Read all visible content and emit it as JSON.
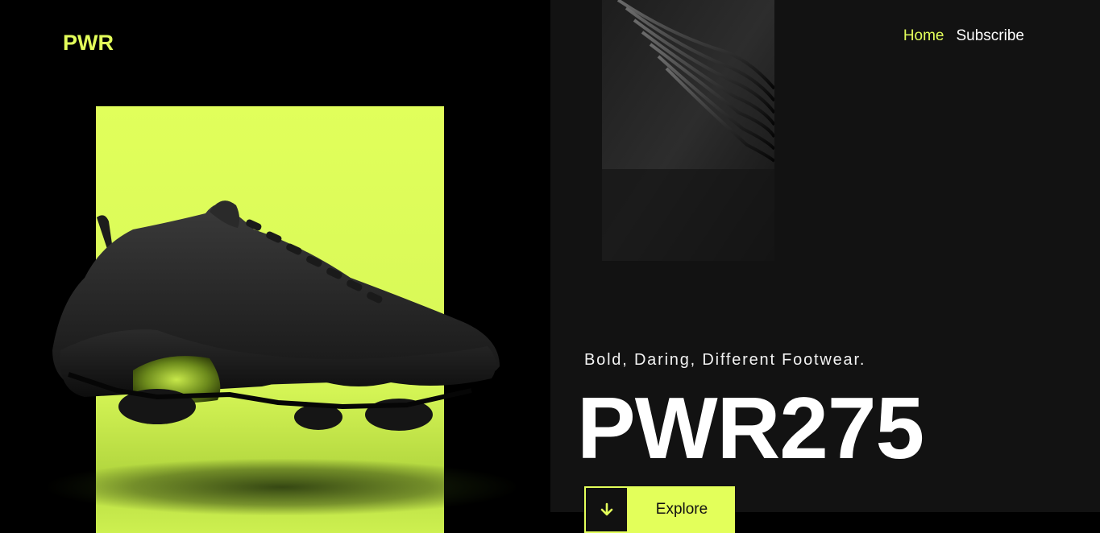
{
  "brand": {
    "logo": "PWR"
  },
  "nav": {
    "items": [
      {
        "label": "Home",
        "active": true
      },
      {
        "label": "Subscribe",
        "active": false
      }
    ]
  },
  "hero": {
    "tagline": "Bold, Daring, Different Footwear.",
    "product_name": "PWR275",
    "cta": {
      "label": "Explore",
      "icon": "arrow-down-icon"
    }
  },
  "colors": {
    "accent": "#e3ff5a",
    "background": "#000000",
    "panel": "#121212"
  }
}
